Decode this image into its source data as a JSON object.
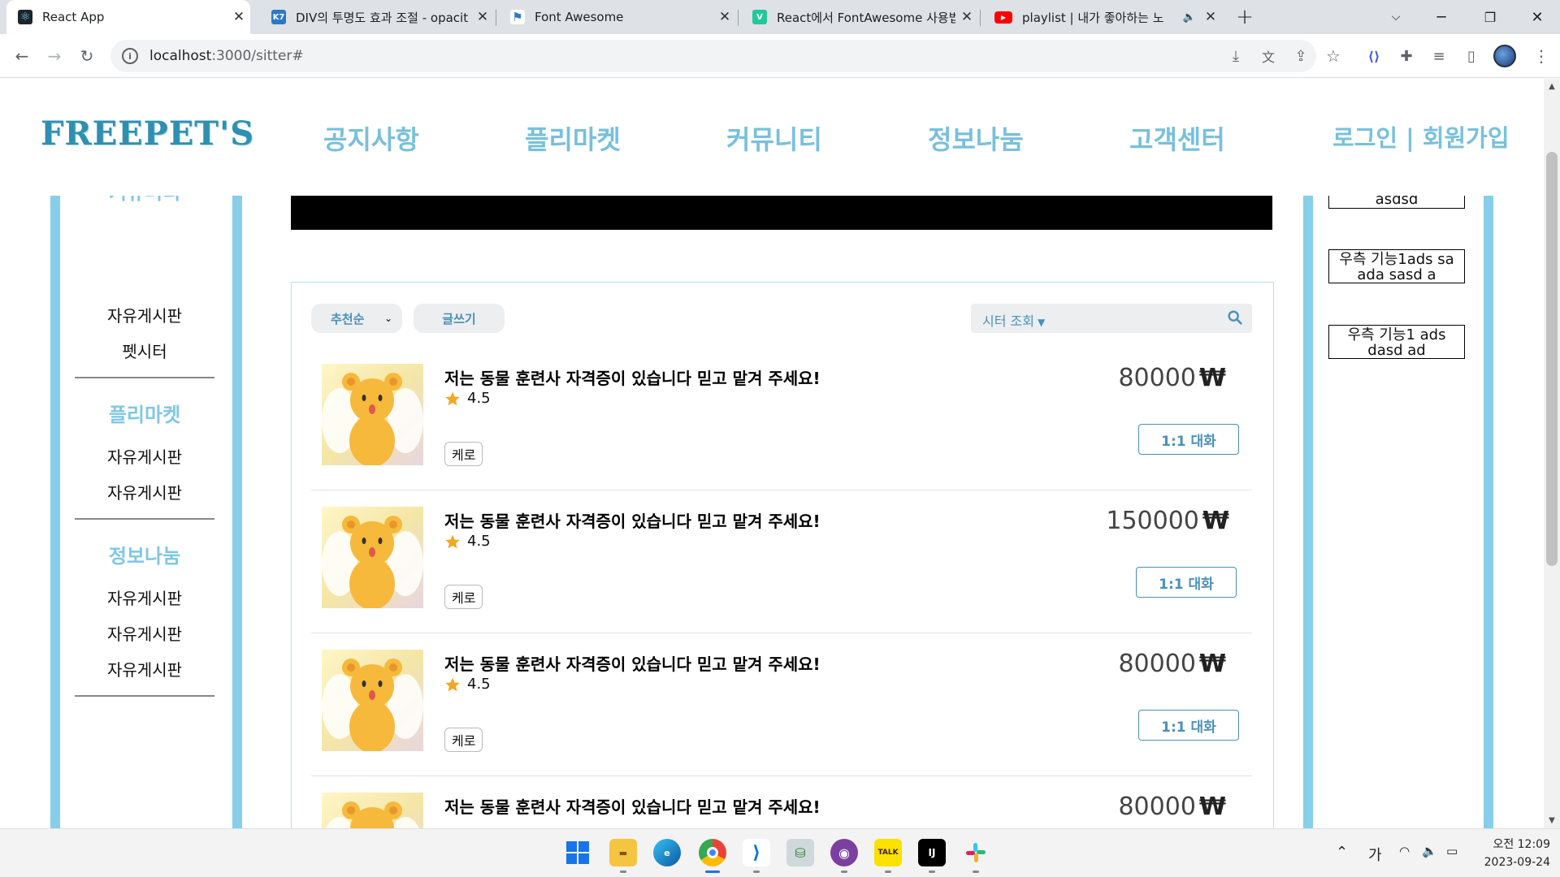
{
  "browser": {
    "tabs": [
      {
        "title": "React App",
        "fav_color": "#20232a",
        "fav_glyph": "⚛",
        "active": true
      },
      {
        "title": "DIV의 투명도 효과 조절 - opacit",
        "fav_color": "#2c78c8",
        "fav_glyph": "K7",
        "active": false
      },
      {
        "title": "Font Awesome",
        "fav_color": "#ffffff",
        "fav_glyph": "⚑",
        "active": false
      },
      {
        "title": "React에서 FontAwesome 사용법",
        "fav_color": "#20c997",
        "fav_glyph": "V",
        "active": false
      },
      {
        "title": "playlist | 내가 좋아하는 노",
        "fav_color": "#ff0000",
        "fav_glyph": "▶",
        "active": false
      }
    ],
    "new_tab": "+",
    "url_host": "localhost",
    "url_rest": ":3000/sitter#"
  },
  "site": {
    "logo": "FREEPET'S",
    "nav": [
      "공지사항",
      "플리마켓",
      "커뮤니티",
      "정보나눔",
      "고객센터"
    ],
    "auth": "로그인 | 회원가입"
  },
  "sidebar": {
    "cut_group": "커뮤니티",
    "group1_items": [
      "자유게시판",
      "펫시터"
    ],
    "group2_title": "플리마켓",
    "group2_items": [
      "자유게시판",
      "자유게시판"
    ],
    "group3_title": "정보나눔",
    "group3_items": [
      "자유게시판",
      "자유게시판",
      "자유게시판"
    ]
  },
  "controls": {
    "sort_label": "추천순",
    "write_label": "글쓰기",
    "search_filter": "시터 조회"
  },
  "listings": [
    {
      "title": "저는 동물 훈련사 자격증이 있습니다 믿고 맡겨 주세요!",
      "rating": "4.5",
      "tag": "케로",
      "price": "80000",
      "currency": "₩",
      "chat": "1:1 대화"
    },
    {
      "title": "저는 동물 훈련사 자격증이 있습니다 믿고 맡겨 주세요!",
      "rating": "4.5",
      "tag": "케로",
      "price": "150000",
      "currency": "₩",
      "chat": "1:1 대화"
    },
    {
      "title": "저는 동물 훈련사 자격증이 있습니다 믿고 맡겨 주세요!",
      "rating": "4.5",
      "tag": "케로",
      "price": "80000",
      "currency": "₩",
      "chat": "1:1 대화"
    },
    {
      "title": "저는 동물 훈련사 자격증이 있습니다 믿고 맡겨 주세요!",
      "rating": "",
      "tag": "",
      "price": "80000",
      "currency": "₩",
      "chat": ""
    }
  ],
  "right_sidebar": {
    "box1": "asdsd",
    "box2": "우측 기능1ads sa ada sasd a",
    "box3": "우측 기능1 ads dasd ad"
  },
  "taskbar": {
    "ime": "가",
    "time": "오전 12:09",
    "date": "2023-09-24"
  },
  "colors": {
    "accent": "#87ceeb",
    "nav": "#78c0dc",
    "button": "#4a90b8",
    "star": "#f5a623"
  }
}
